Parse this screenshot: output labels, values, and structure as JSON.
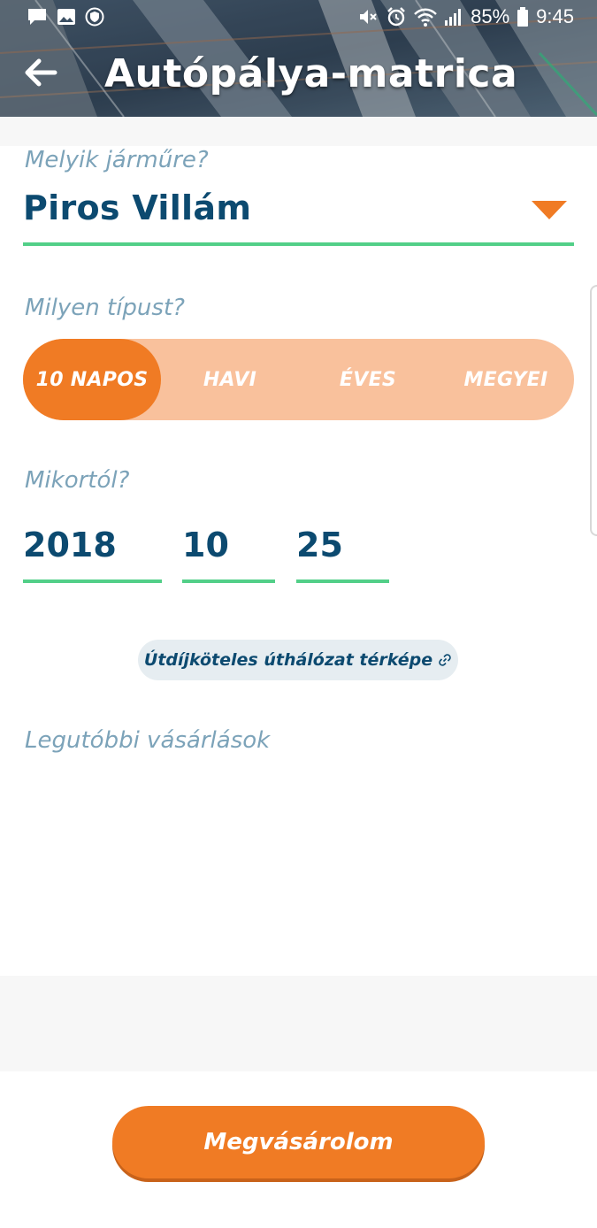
{
  "status_bar": {
    "battery": "85%",
    "time": "9:45",
    "icons_left": [
      "message-icon",
      "image-icon",
      "shield-icon"
    ],
    "icons_right": [
      "mute-icon",
      "alarm-icon",
      "wifi-icon",
      "signal-icon",
      "battery-icon"
    ]
  },
  "header": {
    "title": "Autópálya-matrica",
    "back_icon": "arrow-left-icon"
  },
  "vehicle": {
    "label": "Melyik járműre?",
    "value": "Piros Villám",
    "dropdown_icon": "triangle-down-icon"
  },
  "type": {
    "label": "Milyen típust?",
    "options": [
      "10 NAPOS",
      "HAVI",
      "ÉVES",
      "MEGYEI"
    ],
    "selected": "10 NAPOS"
  },
  "start_date": {
    "label": "Mikortól?",
    "year": "2018",
    "month": "10",
    "day": "25"
  },
  "map_link": {
    "label": "Útdíjköteles úthálózat térképe",
    "icon": "link-icon"
  },
  "recent": {
    "label": "Legutóbbi vásárlások"
  },
  "buy_button": {
    "label": "Megvásárolom"
  },
  "colors": {
    "accent": "#f07b24",
    "accent_light": "#f9c19c",
    "underline": "#52cf88",
    "navy": "#0c4a70",
    "label": "#7ca3b9"
  }
}
